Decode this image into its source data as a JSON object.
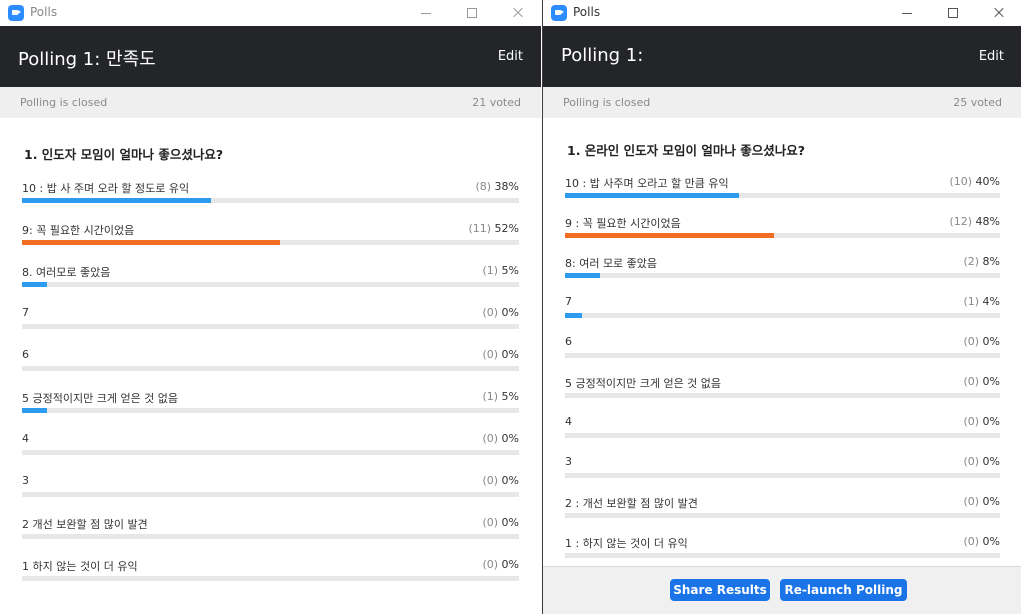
{
  "windows": [
    {
      "title": "Polls",
      "header_title": "Polling 1: 만족도",
      "edit_label": "Edit",
      "status_text": "Polling is closed",
      "voted_text": "21 voted",
      "question": "1. 인도자 모임이 얼마나 좋으셨나요?",
      "options": [
        {
          "label": "10 : 밥 사 주며 오라 할 정도로 유익",
          "count": "(8)",
          "percent": "38%",
          "fraction": 0.38
        },
        {
          "label": "9: 꼭 필요한 시간이었음",
          "count": "(11)",
          "percent": "52%",
          "fraction": 0.52
        },
        {
          "label": "8. 여러모로 좋았음",
          "count": "(1)",
          "percent": "5%",
          "fraction": 0.05
        },
        {
          "label": "7",
          "count": "(0)",
          "percent": "0%",
          "fraction": 0
        },
        {
          "label": "6",
          "count": "(0)",
          "percent": "0%",
          "fraction": 0
        },
        {
          "label": "5 긍정적이지만 크게 얻은 것 없음",
          "count": "(1)",
          "percent": "5%",
          "fraction": 0.05
        },
        {
          "label": "4",
          "count": "(0)",
          "percent": "0%",
          "fraction": 0
        },
        {
          "label": "3",
          "count": "(0)",
          "percent": "0%",
          "fraction": 0
        },
        {
          "label": "2 개선 보완할 점 많이 발견",
          "count": "(0)",
          "percent": "0%",
          "fraction": 0
        },
        {
          "label": "1 하지 않는 것이 더 유익",
          "count": "(0)",
          "percent": "0%",
          "fraction": 0
        }
      ]
    },
    {
      "title": "Polls",
      "header_title": "Polling 1:",
      "edit_label": "Edit",
      "status_text": "Polling is closed",
      "voted_text": "25 voted",
      "question": "1. 온라인 인도자 모임이 얼마나 좋으셨나요?",
      "options": [
        {
          "label": "10 : 밥 사주며 오라고 할 만큼 유익",
          "count": "(10)",
          "percent": "40%",
          "fraction": 0.4
        },
        {
          "label": "9 : 꼭 필요한 시간이었음",
          "count": "(12)",
          "percent": "48%",
          "fraction": 0.48
        },
        {
          "label": "8: 여러 모로 좋았음",
          "count": "(2)",
          "percent": "8%",
          "fraction": 0.08
        },
        {
          "label": "7",
          "count": "(1)",
          "percent": "4%",
          "fraction": 0.04
        },
        {
          "label": "6",
          "count": "(0)",
          "percent": "0%",
          "fraction": 0
        },
        {
          "label": "5 긍정적이지만 크게 얻은 것 없음",
          "count": "(0)",
          "percent": "0%",
          "fraction": 0
        },
        {
          "label": "4",
          "count": "(0)",
          "percent": "0%",
          "fraction": 0
        },
        {
          "label": "3",
          "count": "(0)",
          "percent": "0%",
          "fraction": 0
        },
        {
          "label": "2 : 개선 보완할 점 많이 발견",
          "count": "(0)",
          "percent": "0%",
          "fraction": 0
        },
        {
          "label": "1 : 하지 않는 것이 더 유익",
          "count": "(0)",
          "percent": "0%",
          "fraction": 0
        }
      ],
      "footer": {
        "share_label": "Share Results",
        "relaunch_label": "Re-launch Polling"
      }
    }
  ],
  "colors": {
    "header_bg": "#232528",
    "bar_blue": "#2d9bf0",
    "bar_orange": "#f26d21",
    "button_blue": "#1b73e8"
  },
  "icons": {
    "app": "zoom-camera-icon",
    "minimize": "minimize-icon",
    "maximize": "maximize-icon",
    "close": "close-icon"
  }
}
